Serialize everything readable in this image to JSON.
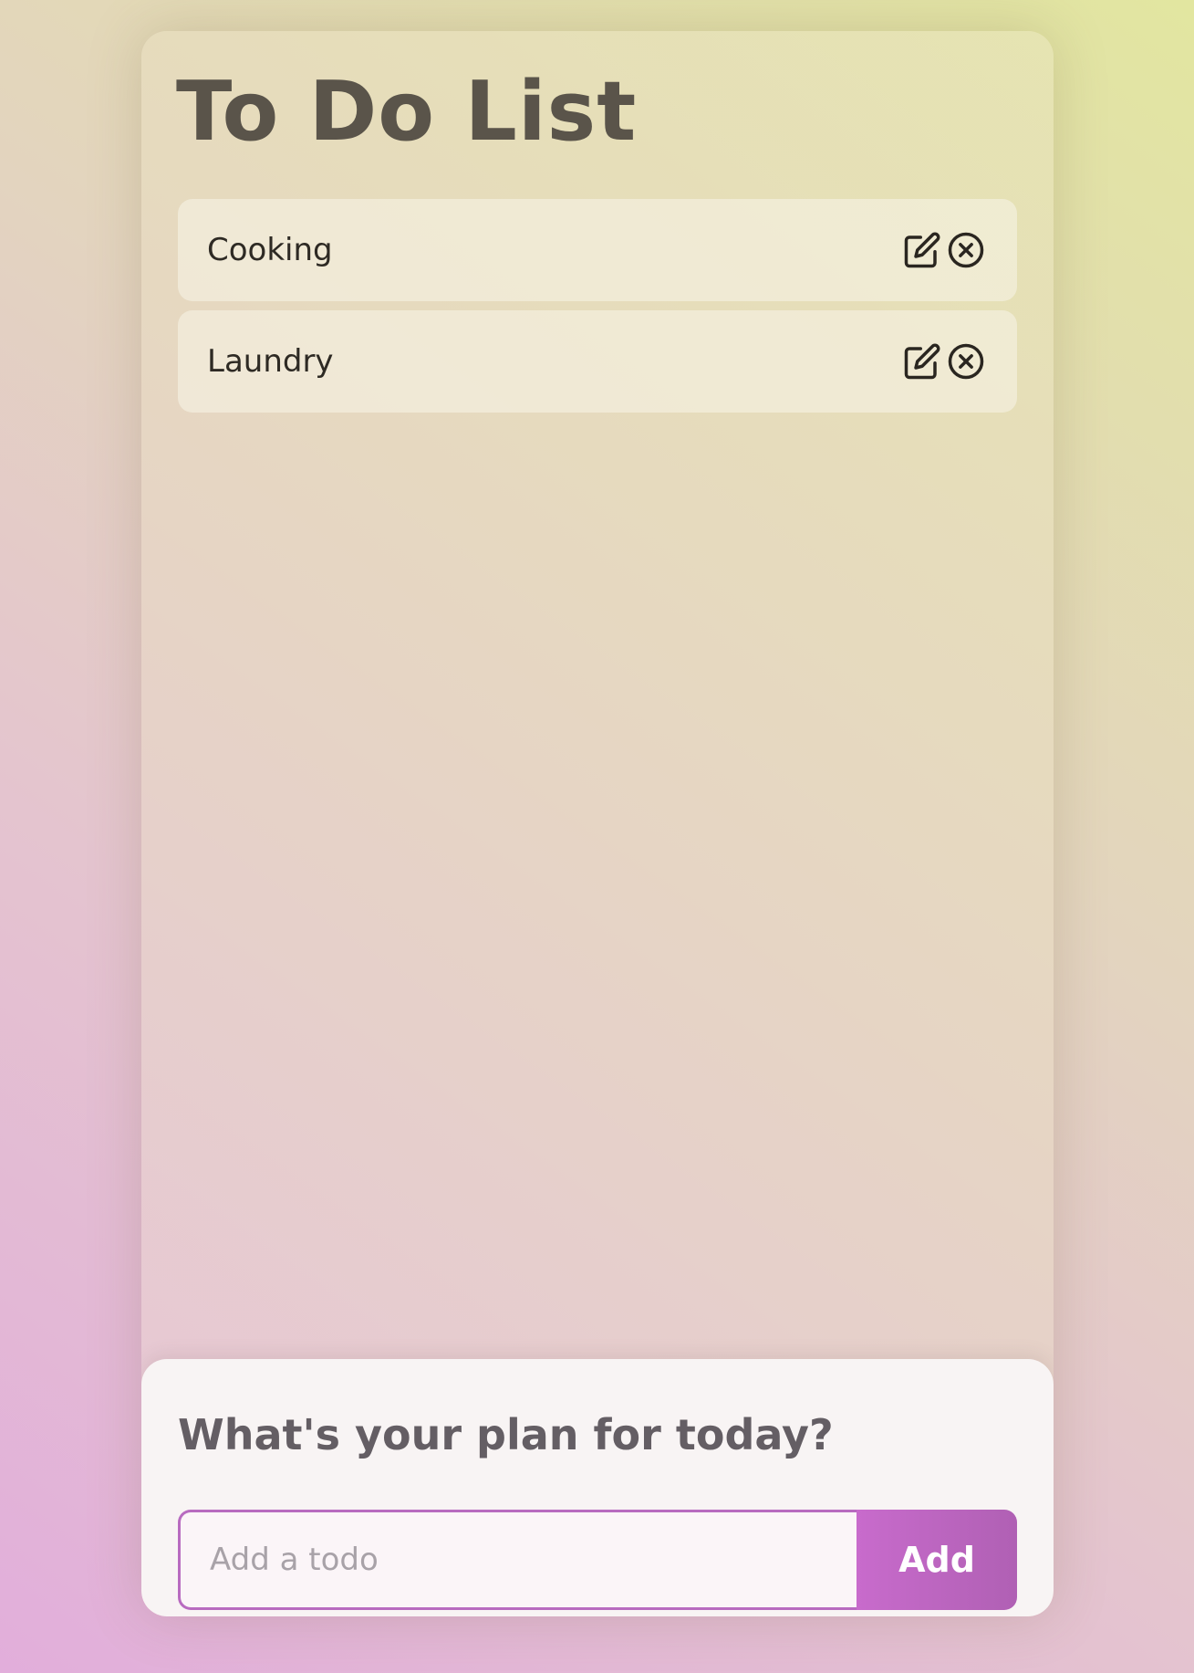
{
  "app": {
    "title": "To Do List"
  },
  "todos": [
    {
      "text": "Cooking",
      "edit_icon": "edit-icon",
      "delete_icon": "close-circle-icon"
    },
    {
      "text": "Laundry",
      "edit_icon": "edit-icon",
      "delete_icon": "close-circle-icon"
    }
  ],
  "composer": {
    "prompt": "What's your plan for today?",
    "input_placeholder": "Add a todo",
    "input_value": "",
    "add_label": "Add"
  },
  "colors": {
    "accent": "#c86bcc",
    "accent_border": "#b86bc0",
    "title_text": "#5a544a",
    "item_text": "#2e2a24"
  }
}
